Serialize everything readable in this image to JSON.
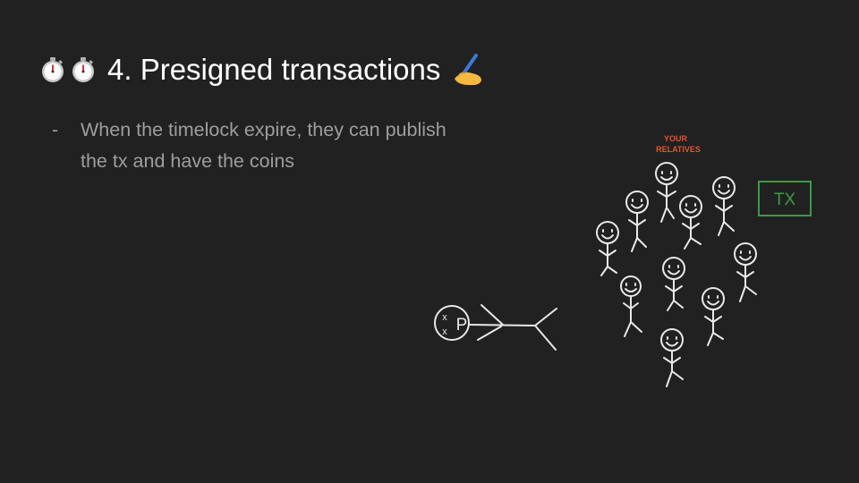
{
  "slide": {
    "title": "4. Presigned transactions",
    "title_icons": [
      "stopwatch-icon",
      "stopwatch-icon",
      "writing-hand-icon"
    ],
    "bullet_marker": "-",
    "bullet_text": "When the timelock expire, they can publish the tx and have the coins"
  },
  "illustration": {
    "relatives_label_line1": "YOUR",
    "relatives_label_line2": "RELATIVES",
    "tx_label": "TX",
    "person_label": "P",
    "dead_eyes": "x",
    "colors": {
      "relatives_label": "#e0562a",
      "tx_box": "#3e9a46",
      "chalk": "#e8e8e8"
    }
  }
}
